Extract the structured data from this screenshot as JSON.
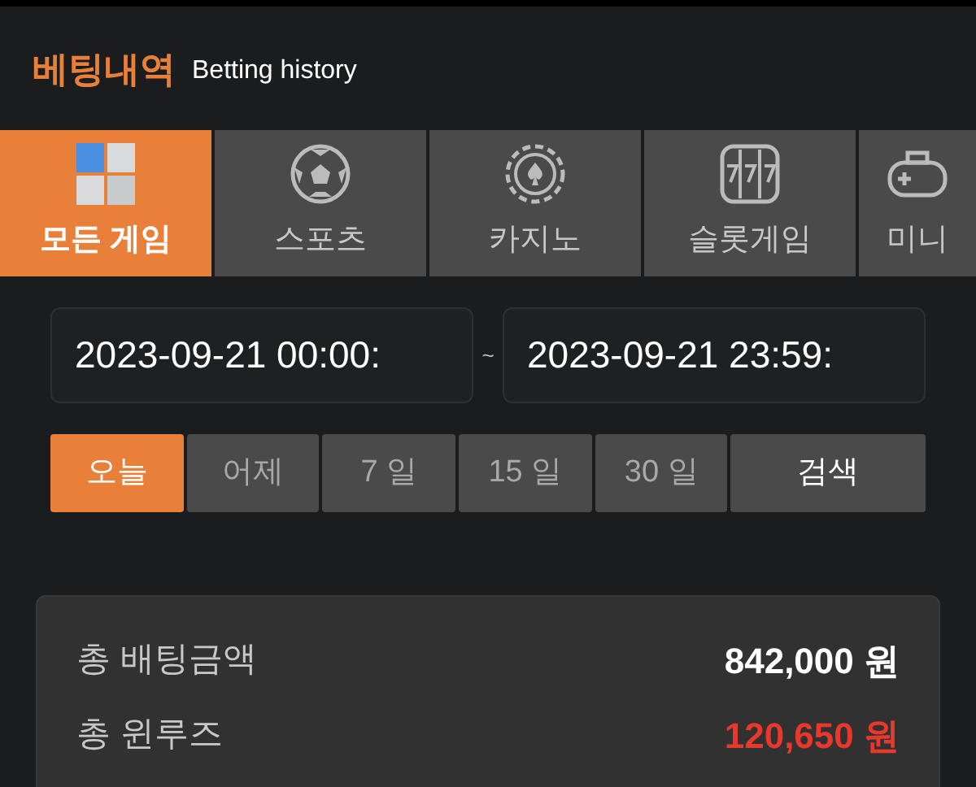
{
  "header": {
    "title": "베팅내역",
    "subtitle": "Betting history"
  },
  "tabs": [
    {
      "label": "모든 게임",
      "kind": "all",
      "selected": true
    },
    {
      "label": "스포츠",
      "kind": "sports",
      "selected": false
    },
    {
      "label": "카지노",
      "kind": "casino",
      "selected": false
    },
    {
      "label": "슬롯게임",
      "kind": "slot",
      "selected": false
    },
    {
      "label": "미니",
      "kind": "mini",
      "selected": false
    }
  ],
  "date_range": {
    "start": "2023-09-21 00:00:",
    "separator": "~",
    "end": "2023-09-21 23:59:"
  },
  "presets": [
    {
      "label": "오늘",
      "selected": true
    },
    {
      "label": "어제",
      "selected": false
    },
    {
      "label": "7 일",
      "selected": false
    },
    {
      "label": "15 일",
      "selected": false
    },
    {
      "label": "30 일",
      "selected": false
    }
  ],
  "search_button": "검색",
  "summary": [
    {
      "label": "총 배팅금액",
      "value": "842,000 원",
      "color": "#ffffff"
    },
    {
      "label": "총 윈루즈",
      "value": "120,650 원",
      "color": "#e8382b"
    }
  ]
}
